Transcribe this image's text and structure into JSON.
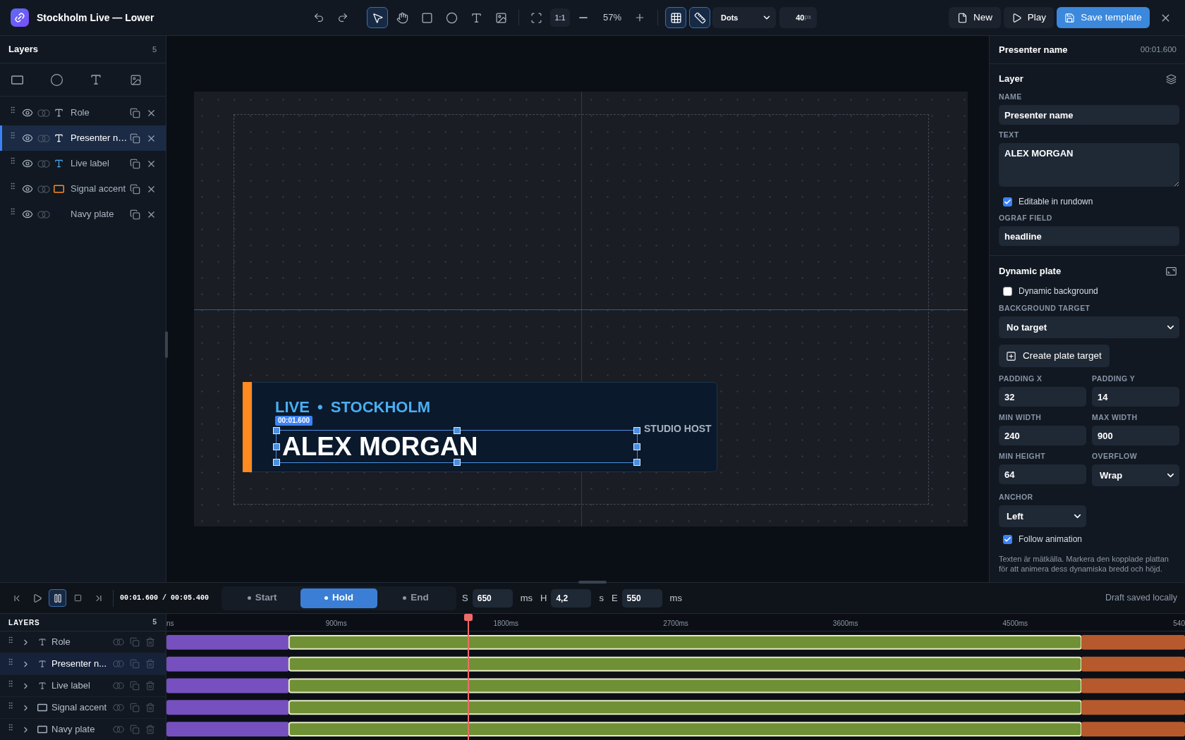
{
  "app": {
    "title": "Stockholm Live — Lower"
  },
  "toolbar": {
    "tools": [
      {
        "kind": "select",
        "selected": true
      },
      {
        "kind": "hand",
        "selected": false
      },
      {
        "kind": "rect",
        "selected": false
      },
      {
        "kind": "ellipse",
        "selected": false
      },
      {
        "kind": "text",
        "selected": false
      },
      {
        "kind": "image",
        "selected": false
      }
    ],
    "zoom_reset": "1:1",
    "zoom": "57%",
    "view_toggles": [
      {
        "kind": "grid",
        "on": true
      },
      {
        "kind": "ruler",
        "on": true
      }
    ],
    "grid_style": "Dots",
    "grid_size": {
      "value": "40",
      "unit": "px"
    },
    "actions": [
      {
        "kind": "new",
        "label": "New"
      },
      {
        "kind": "play",
        "label": "Play"
      },
      {
        "kind": "save",
        "label": "Save template"
      }
    ]
  },
  "layers_panel": {
    "title": "Layers",
    "count": "5",
    "layers": [
      {
        "name": "Role",
        "kind": "text",
        "color": "#a8b3c1",
        "visible": true,
        "selected": false
      },
      {
        "name": "Presenter n…",
        "kind": "text",
        "color": "#ffffff",
        "visible": true,
        "selected": true
      },
      {
        "name": "Live label",
        "kind": "text",
        "color": "#4aaef3",
        "visible": true,
        "selected": false
      },
      {
        "name": "Signal accent",
        "kind": "rect",
        "color": "#ff8a1f",
        "visible": true,
        "selected": false
      },
      {
        "name": "Navy plate",
        "kind": "rect",
        "color": "#0a192b",
        "visible": true,
        "selected": false
      }
    ]
  },
  "canvas": {
    "live_label": "LIVE • STOCKHOLM",
    "time_badge": "00:01.600",
    "name": "ALEX MORGAN",
    "role": "STUDIO HOST"
  },
  "inspector": {
    "title": "Presenter name",
    "time": "00:01.600",
    "layer_section": {
      "title": "Layer",
      "name": {
        "label": "NAME",
        "value": "Presenter name"
      },
      "text": {
        "label": "TEXT",
        "value": "ALEX MORGAN"
      },
      "editable": {
        "label": "Editable in rundown",
        "checked": true
      },
      "ograf_field": {
        "label": "OGRAF FIELD",
        "value": "headline"
      }
    },
    "plate_section": {
      "title": "Dynamic plate",
      "dynamic_background": {
        "label": "Dynamic background",
        "checked": false
      },
      "background_target": {
        "label": "BACKGROUND TARGET",
        "value": "No target"
      },
      "create_button": "Create plate target",
      "fields": [
        {
          "label": "PADDING X",
          "value": "32",
          "kind": "input"
        },
        {
          "label": "PADDING Y",
          "value": "14",
          "kind": "input"
        },
        {
          "label": "MIN WIDTH",
          "value": "240",
          "kind": "input"
        },
        {
          "label": "MAX WIDTH",
          "value": "900",
          "kind": "input"
        },
        {
          "label": "MIN HEIGHT",
          "value": "64",
          "kind": "input"
        },
        {
          "label": "OVERFLOW",
          "value": "Wrap",
          "kind": "select"
        },
        {
          "label": "ANCHOR",
          "value": "Left",
          "kind": "select"
        }
      ],
      "follow_animation": {
        "label": "Follow animation",
        "checked": true
      },
      "help": "Texten är mätkälla. Markera den kopplade plattan för att animera dess dynamiska bredd och höjd."
    }
  },
  "transport": {
    "buttons": [
      {
        "kind": "first",
        "active": false
      },
      {
        "kind": "play",
        "active": false
      },
      {
        "kind": "pause",
        "active": true
      },
      {
        "kind": "stop",
        "active": false
      },
      {
        "kind": "last",
        "active": false
      }
    ],
    "time": "00:01.600 / 00:05.400",
    "phases": [
      {
        "label": "Start",
        "selected": false
      },
      {
        "label": "Hold",
        "selected": true
      },
      {
        "label": "End",
        "selected": false
      }
    ],
    "durations": [
      {
        "key": "S",
        "value": "650",
        "unit": "ms"
      },
      {
        "key": "H",
        "value": "4,2",
        "unit": "s"
      },
      {
        "key": "E",
        "value": "550",
        "unit": "ms"
      }
    ],
    "status": "Draft saved locally"
  },
  "timeline": {
    "title": "LAYERS",
    "count": "5",
    "ruler_end_label": "540",
    "tracks": [
      {
        "kind": "text",
        "selected": false
      },
      {
        "kind": "text",
        "selected": true
      },
      {
        "kind": "text",
        "selected": false
      },
      {
        "kind": "rect",
        "selected": false
      },
      {
        "kind": "rect",
        "selected": false
      }
    ],
    "chart_data": {
      "type": "bar",
      "orientation": "horizontal",
      "stacked": true,
      "categories": [
        "Role",
        "Presenter n...",
        "Live label",
        "Signal accent",
        "Navy plate"
      ],
      "series": [
        {
          "color": "#7750bf",
          "values": [
            650,
            650,
            650,
            650,
            650
          ]
        },
        {
          "color": "#6f9034",
          "values": [
            4200,
            4200,
            4200,
            4200,
            4200
          ]
        },
        {
          "color": "#b65a2e",
          "values": [
            550,
            550,
            550,
            550,
            550
          ]
        }
      ],
      "xlim": [
        0,
        5400
      ],
      "xticks": [
        {
          "value": 0,
          "label": "ns"
        },
        {
          "value": 900,
          "label": "900ms"
        },
        {
          "value": 1800,
          "label": "1800ms"
        },
        {
          "value": 2700,
          "label": "2700ms"
        },
        {
          "value": 3600,
          "label": "3600ms"
        },
        {
          "value": 4500,
          "label": "4500ms"
        }
      ],
      "ref_lines": [
        {
          "axis": "x",
          "value": 1600,
          "color": "#f06a6a"
        }
      ]
    }
  }
}
